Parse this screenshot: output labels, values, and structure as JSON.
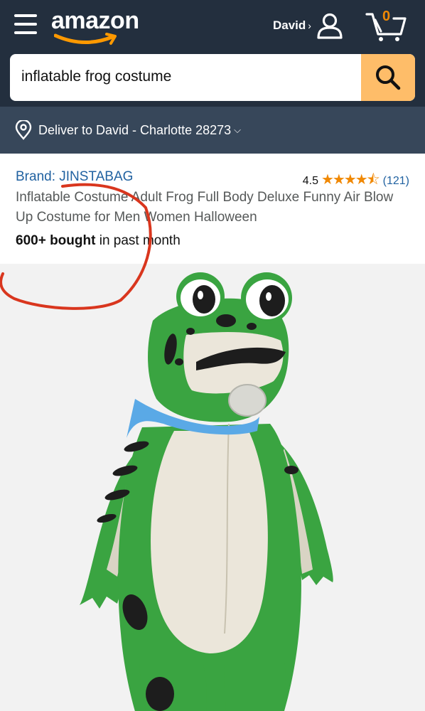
{
  "header": {
    "logo_text": "amazon",
    "account_name": "David",
    "account_chevron": "›",
    "cart_count": "0"
  },
  "search": {
    "query": "inflatable frog costume"
  },
  "delivery": {
    "text": "Deliver to David - Charlotte 28273",
    "chevron": "⌵"
  },
  "product": {
    "brand": "Brand: JINSTABAG",
    "rating_value": "4.5",
    "rating": 4.5,
    "stars": "★★★★⯪",
    "rating_count": "(121)",
    "title": "Inflatable Costume Adult Frog Full Body Deluxe Funny Air Blow Up Costume for Men Women Halloween",
    "bought_bold": "600+ bought",
    "bought_rest": " in past month"
  },
  "colors": {
    "header_bg": "#232f3e",
    "delivery_bg": "#37475a",
    "search_button": "#febd69",
    "link": "#2162a1",
    "star": "#f08804",
    "annotation": "#d9361e"
  },
  "icons": {
    "menu": "menu-icon",
    "account": "person-icon",
    "cart": "cart-icon",
    "search": "search-icon",
    "location": "location-pin-icon"
  }
}
